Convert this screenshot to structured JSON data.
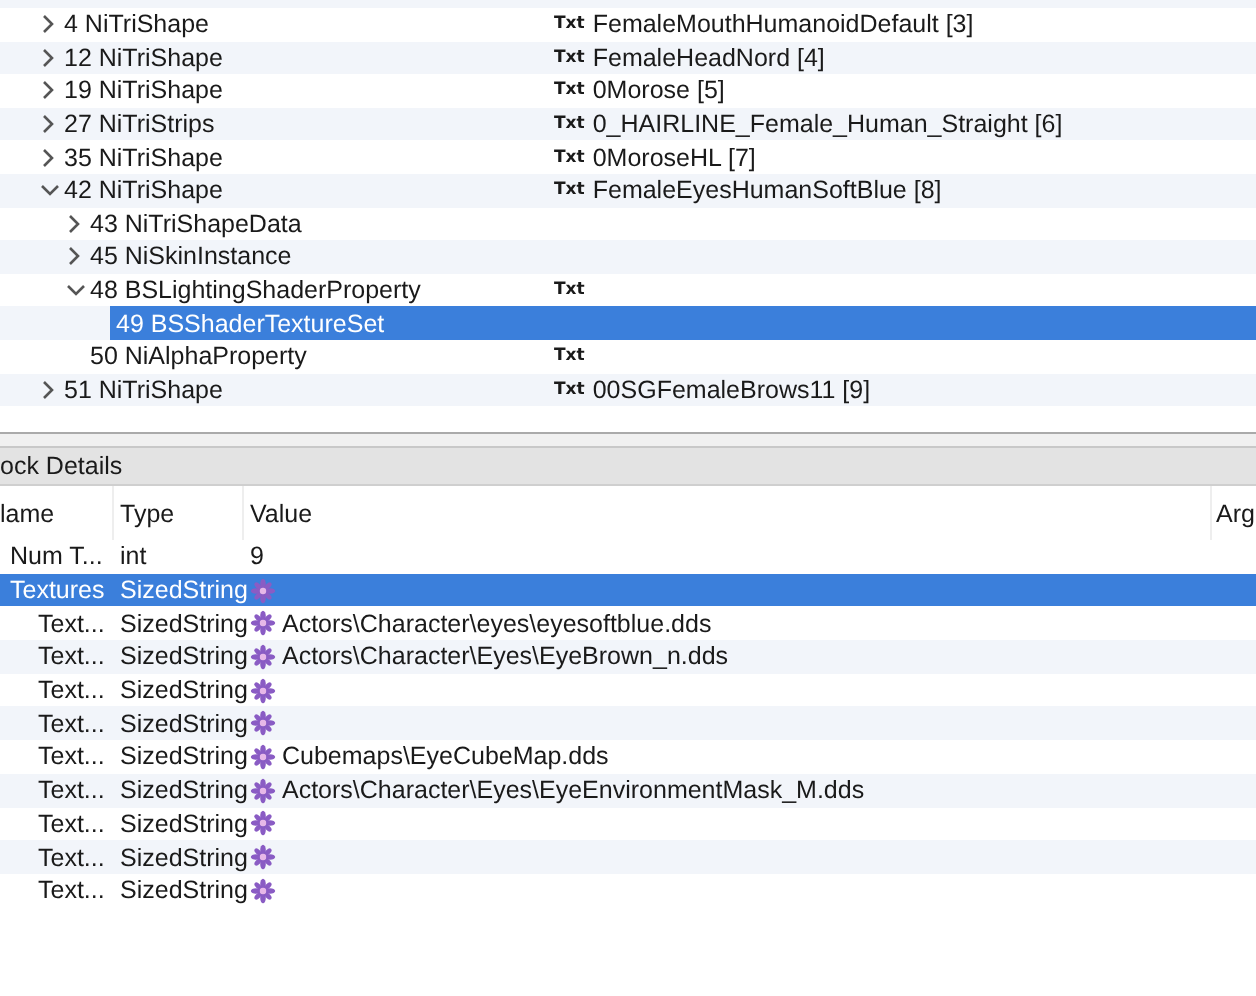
{
  "tree": {
    "items": [
      {
        "label": "4 NiTriShape",
        "kind": "branch",
        "expanded": false,
        "selected": false,
        "tag": "Txt",
        "value": "FemaleMouthHumanoidDefault [3]"
      },
      {
        "label": "12 NiTriShape",
        "kind": "branch",
        "expanded": false,
        "selected": false,
        "tag": "Txt",
        "value": "FemaleHeadNord [4]"
      },
      {
        "label": "19 NiTriShape",
        "kind": "branch",
        "expanded": false,
        "selected": false,
        "tag": "Txt",
        "value": "0Morose [5]"
      },
      {
        "label": "27 NiTriStrips",
        "kind": "branch",
        "expanded": false,
        "selected": false,
        "tag": "Txt",
        "value": "0_HAIRLINE_Female_Human_Straight [6]"
      },
      {
        "label": "35 NiTriShape",
        "kind": "branch",
        "expanded": false,
        "selected": false,
        "tag": "Txt",
        "value": "0MoroseHL [7]"
      },
      {
        "label": "42 NiTriShape",
        "kind": "branch",
        "expanded": true,
        "selected": false,
        "tag": "Txt",
        "value": "FemaleEyesHumanSoftBlue [8]",
        "children": [
          {
            "label": "43 NiTriShapeData",
            "kind": "branch",
            "expanded": false,
            "selected": false
          },
          {
            "label": "45 NiSkinInstance",
            "kind": "branch",
            "expanded": false,
            "selected": false
          },
          {
            "label": "48 BSLightingShaderProperty",
            "kind": "branch",
            "expanded": true,
            "selected": false,
            "tag": "Txt",
            "children": [
              {
                "label": "49 BSShaderTextureSet",
                "kind": "leaf",
                "selected": true
              }
            ]
          },
          {
            "label": "50 NiAlphaProperty",
            "kind": "leaf",
            "selected": false,
            "tag": "Txt"
          }
        ]
      },
      {
        "label": "51 NiTriShape",
        "kind": "branch",
        "expanded": false,
        "selected": false,
        "tag": "Txt",
        "value": "00SGFemaleBrows11 [9]"
      }
    ]
  },
  "block_details": {
    "title": "ock Details",
    "columns": [
      "lame",
      "Type",
      "Value",
      "Arg"
    ],
    "rows": [
      {
        "name": "Num T...",
        "type": "int",
        "kind": "int",
        "value": "9",
        "selected": false
      },
      {
        "name": "Textures",
        "type": "SizedString",
        "kind": "string",
        "selected": true,
        "children": [
          {
            "name": "Text...",
            "type": "SizedString",
            "kind": "string",
            "value": "Actors\\Character\\eyes\\eyesoftblue.dds",
            "selected": false
          },
          {
            "name": "Text...",
            "type": "SizedString",
            "kind": "string",
            "value": "Actors\\Character\\Eyes\\EyeBrown_n.dds",
            "selected": false
          },
          {
            "name": "Text...",
            "type": "SizedString",
            "kind": "string",
            "selected": false
          },
          {
            "name": "Text...",
            "type": "SizedString",
            "kind": "string",
            "selected": false
          },
          {
            "name": "Text...",
            "type": "SizedString",
            "kind": "string",
            "value": "Cubemaps\\EyeCubeMap.dds",
            "selected": false
          },
          {
            "name": "Text...",
            "type": "SizedString",
            "kind": "string",
            "value": "Actors\\Character\\Eyes\\EyeEnvironmentMask_M.dds",
            "selected": false
          },
          {
            "name": "Text...",
            "type": "SizedString",
            "kind": "string",
            "selected": false
          },
          {
            "name": "Text...",
            "type": "SizedString",
            "kind": "string",
            "selected": false
          },
          {
            "name": "Text...",
            "type": "SizedString",
            "kind": "string",
            "selected": false
          }
        ]
      }
    ]
  }
}
